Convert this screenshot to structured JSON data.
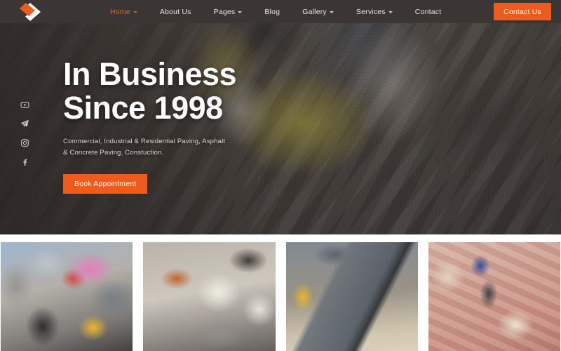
{
  "header": {
    "logo_icon": "rhombus-logo-icon",
    "nav": [
      {
        "label": "Home",
        "has_caret": true,
        "active": true,
        "name": "nav-item-home"
      },
      {
        "label": "About Us",
        "has_caret": false,
        "active": false,
        "name": "nav-item-about-us"
      },
      {
        "label": "Pages",
        "has_caret": true,
        "active": false,
        "name": "nav-item-pages"
      },
      {
        "label": "Blog",
        "has_caret": false,
        "active": false,
        "name": "nav-item-blog"
      },
      {
        "label": "Gallery",
        "has_caret": true,
        "active": false,
        "name": "nav-item-gallery"
      },
      {
        "label": "Services",
        "has_caret": true,
        "active": false,
        "name": "nav-item-services"
      },
      {
        "label": "Contact",
        "has_caret": false,
        "active": false,
        "name": "nav-item-contact"
      }
    ],
    "cta_label": "Contact Us",
    "background_color": "#3b3633",
    "accent_color": "#ef5a1d"
  },
  "hero": {
    "title_line_1": "In Business",
    "title_line_2": "Since 1998",
    "subtitle": "Commercial, Industrial & Residential Paving, Asphalt & Concrete Paving, Constuction.",
    "button_label": "Book Appointment",
    "social": [
      {
        "name": "youtube-icon",
        "label": "YouTube"
      },
      {
        "name": "telegram-icon",
        "label": "Telegram"
      },
      {
        "name": "instagram-icon",
        "label": "Instagram"
      },
      {
        "name": "facebook-icon",
        "label": "Facebook"
      }
    ]
  },
  "gallery": {
    "items": [
      {
        "name": "gallery-image-1",
        "alt": "Worker in grey shirt and pink cap laying concrete block wall"
      },
      {
        "name": "gallery-image-2",
        "alt": "White-gloved hands setting a grey paving stone beside an orange brick"
      },
      {
        "name": "gallery-image-3",
        "alt": "Yellow-gloved worker carrying a dark granite kerb stone"
      },
      {
        "name": "gallery-image-4",
        "alt": "Hand with blue cuff tapping red brick pavers with a rubber mallet"
      }
    ]
  }
}
